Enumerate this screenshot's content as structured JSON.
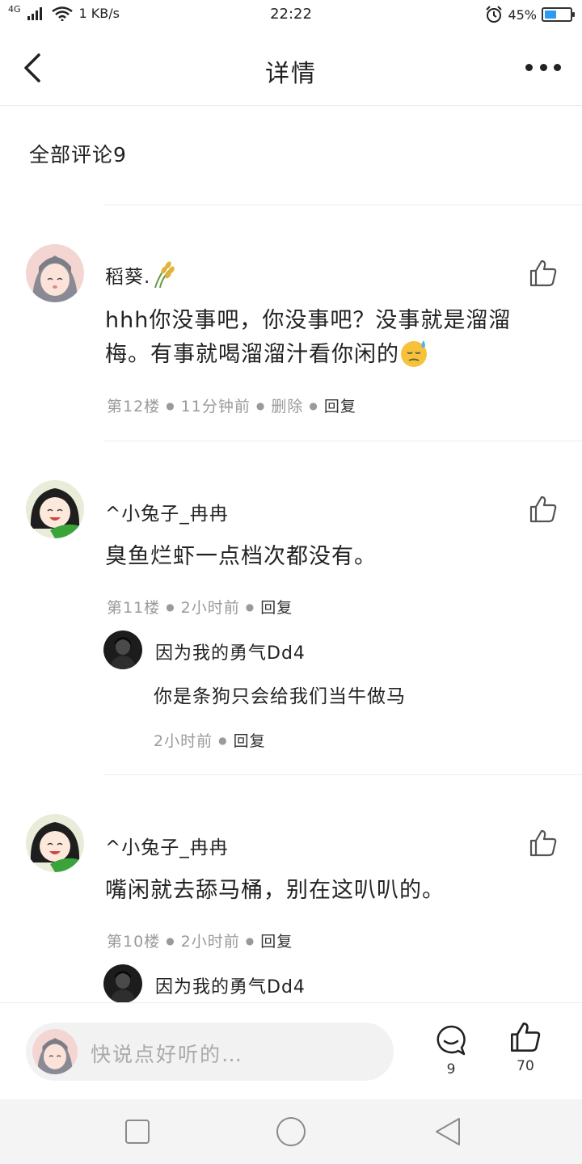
{
  "status_bar": {
    "network": "4G",
    "speed": "1 KB/s",
    "time": "22:22",
    "battery": "45%",
    "battery_level": 0.45
  },
  "header": {
    "title": "详情"
  },
  "comments_header": {
    "label": "全部评论9"
  },
  "comments": [
    {
      "name": "稻葵.",
      "text": "hhh你没事吧，你没事吧？没事就是溜溜梅。有事就喝溜溜汁看你闲的",
      "floor": "第12楼",
      "time": "11分钟前",
      "delete": "删除",
      "reply": "回复"
    },
    {
      "name": "^小兔子_冉冉",
      "text": "臭鱼烂虾一点档次都没有。",
      "floor": "第11楼",
      "time": "2小时前",
      "reply": "回复",
      "sub_reply": {
        "name": "因为我的勇气Dd4",
        "text": "你是条狗只会给我们当牛做马",
        "time": "2小时前",
        "reply": "回复"
      }
    },
    {
      "name": "^小兔子_冉冉",
      "text": "嘴闲就去舔马桶，别在这叭叭的。",
      "floor": "第10楼",
      "time": "2小时前",
      "reply": "回复",
      "sub_reply": {
        "name": "因为我的勇气Dd4"
      }
    }
  ],
  "bottom_bar": {
    "placeholder": "快说点好听的…",
    "comment_count": "9",
    "like_count": "70"
  },
  "colors": {
    "accent_battery": "#2f9bf0",
    "meta_gray": "#9a9a9a",
    "divider": "#ececec"
  },
  "icons": [
    "back-arrow-icon",
    "more-dots-icon",
    "thumbs-up-icon",
    "comment-bubble-icon",
    "square-nav-icon",
    "circle-nav-icon",
    "triangle-back-nav-icon",
    "wheat-icon",
    "sweat-emoji-icon"
  ]
}
